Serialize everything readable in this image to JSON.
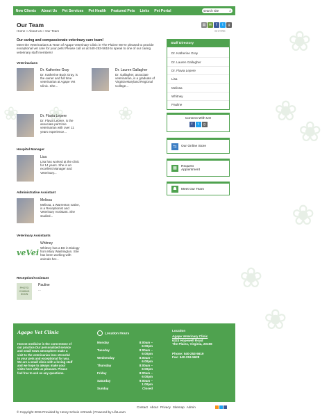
{
  "nav": {
    "items": [
      "New Clients",
      "About Us",
      "Pet Services",
      "Pet Health",
      "Featured Pets",
      "Links",
      "Pet Portal"
    ],
    "search_placeholder": "search site"
  },
  "page": {
    "title": "Our Team",
    "breadcrumb": "Home » About Us » Our Team",
    "share_label": "SHARE",
    "intro_heading": "Our caring and compassionate veterinary care team!",
    "intro_text": "Meet the Veterinarians & Team of Agape Veterinary Clinic in The Plains! We're pleased to provide exceptional vet care for your pets! Please call us at 540-253-5619 to speak to one of our caring veterinary staff members!"
  },
  "sections": {
    "veterinarians": "Veterinarians",
    "hospital_manager": "Hospital Manager",
    "administrative_assistant": "Administrative Assistant",
    "veterinary_assistants": "Veterinary Assistants",
    "reception": "Reception/Assistant"
  },
  "staff": {
    "gray": {
      "name": "Dr. Katherine Gray",
      "bio": "Dr. Katherine Buck Gray, is the owner and full time veterinarian at Agape Vet Clinic. She..."
    },
    "gallagher": {
      "name": "Dr. Lauren Gallagher",
      "bio": "Dr. Gallagher, associate veterinarian, is a graduate of Virginia-Maryland Regional College..."
    },
    "lepere": {
      "name": "Dr. Flavia Lepere",
      "bio": "Dr. Flavia Lepere, is the associate part time veterinarian with over 11 years experience..."
    },
    "lisa": {
      "name": "Lisa",
      "bio": "Lisa has worked at the clinic for 14 years. She is an excellent Manager and Veterinary..."
    },
    "melissa": {
      "name": "Melissa",
      "bio": "Melissa, a Warrenton native, is a Receptionist and Veterinary Assistant. She studied..."
    },
    "whitney": {
      "name": "Whitney",
      "bio": "Whitney has a BS in Biology from Mary Washington. She has been working with animals her..."
    },
    "pauline": {
      "name": "Pauline",
      "bio": "...",
      "photo_text": "PHOTO COMING SOON"
    }
  },
  "sidebar": {
    "directory_title": "Staff Directory",
    "directory": [
      "Dr. Katherine Gray",
      "Dr. Lauren Gallagher",
      "Dr. Flavia Lepere",
      "Lisa",
      "Melissa",
      "Whitney",
      "Pauline"
    ],
    "connect_title": "Connect With Us!",
    "store": "Our Online Store",
    "appointment": "Request Appointment",
    "meet_team": "Meet Our Team"
  },
  "footer": {
    "logo": "Agape Vet Clinic",
    "mission": "Honest medicine is the cornerstone of our practice.Our personalized service and small town atmosphere make a visit to the veterinarian less stressful to your pets and exceptional for you. We are a small clinic with a loving staff and we hope to always make your visits here with us pleasant. Please feel free to ask us any questions.",
    "hours_title": "Location Hours",
    "hours": [
      {
        "day": "Monday",
        "time": "8:00am – 6:00pm"
      },
      {
        "day": "Tuesday",
        "time": "8:00am – 6:00pm"
      },
      {
        "day": "Wednesday",
        "time": "8:00am – 6:00pm"
      },
      {
        "day": "Thursday",
        "time": "8:00am – 6:00pm"
      },
      {
        "day": "Friday",
        "time": "8:00am – 6:00pm"
      },
      {
        "day": "Saturday",
        "time": "9:00am – 1:00pm"
      },
      {
        "day": "Sunday",
        "time": "Closed"
      }
    ],
    "location_title": "Location",
    "clinic_name": "Agape Veterinary Clinic",
    "address1": "6323 Hopewell Road",
    "address2": "The Plains, Virginia, 20198",
    "phone": "Phone: 540-253-5619",
    "fax": "Fax: 540-253-5628"
  },
  "bottom": {
    "links": [
      "Contact",
      "About",
      "Privacy",
      "Sitemap",
      "Admin"
    ],
    "copyright": "© Copyright 2015 Provided by Henry Schein AVImark | Powered by LifeLearn"
  },
  "colors": {
    "accent": "#4fa24f"
  }
}
